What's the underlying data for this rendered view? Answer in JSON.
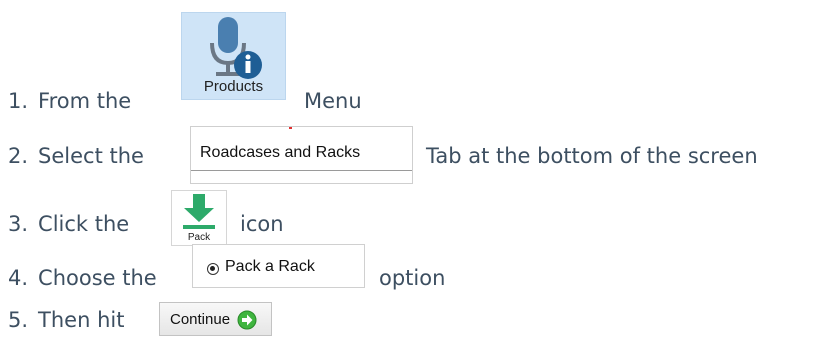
{
  "steps": [
    {
      "num": "1.",
      "before": "From the",
      "after": "Menu"
    },
    {
      "num": "2.",
      "before": "Select the",
      "after": "Tab at the bottom of the screen"
    },
    {
      "num": "3.",
      "before": "Click the",
      "after": "icon"
    },
    {
      "num": "4.",
      "before": "Choose the",
      "after": "option"
    },
    {
      "num": "5.",
      "before": "Then hit",
      "after": ""
    }
  ],
  "products_button": {
    "label": "Products",
    "icon": "microphone-info-icon",
    "bg": "#cfe4f7"
  },
  "tab": {
    "label": "Roadcases and Racks"
  },
  "pack_button": {
    "label": "Pack",
    "icon": "download-arrow-icon",
    "color": "#2daa6a"
  },
  "radio_option": {
    "label": "Pack a Rack",
    "checked": true
  },
  "continue_button": {
    "label": "Continue",
    "icon": "green-arrow-right-icon"
  },
  "colors": {
    "text": "#3d4f61",
    "mic": "#4a7fb0",
    "info": "#1f5e95"
  }
}
